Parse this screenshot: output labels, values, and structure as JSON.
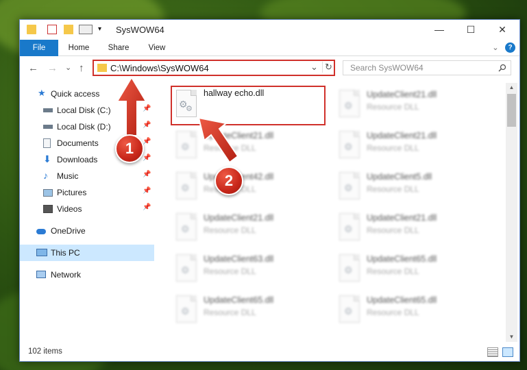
{
  "window": {
    "title": "SysWOW64",
    "minimize_glyph": "—",
    "maximize_glyph": "☐",
    "close_glyph": "✕"
  },
  "ribbon": {
    "tabs": [
      "File",
      "Home",
      "Share",
      "View"
    ],
    "expand_glyph": "⌄",
    "help_glyph": "?"
  },
  "address": {
    "path": "C:\\Windows\\SysWOW64",
    "dropdown_glyph": "⌄",
    "refresh_glyph": "↻"
  },
  "search": {
    "placeholder": "Search SysWOW64",
    "icon": "magnifier-icon"
  },
  "nav": {
    "back": "←",
    "forward": "→",
    "recent": "⌄",
    "up": "↑"
  },
  "sidebar": {
    "items": [
      {
        "label": "Quick access",
        "icon": "star-icon"
      },
      {
        "label": "Local Disk (C:)",
        "icon": "drive-icon",
        "pinned": true
      },
      {
        "label": "Local Disk (D:)",
        "icon": "drive-icon",
        "pinned": true
      },
      {
        "label": "Documents",
        "icon": "documents-icon",
        "pinned": true
      },
      {
        "label": "Downloads",
        "icon": "download-icon",
        "pinned": true
      },
      {
        "label": "Music",
        "icon": "music-icon",
        "pinned": true
      },
      {
        "label": "Pictures",
        "icon": "pictures-icon",
        "pinned": true
      },
      {
        "label": "Videos",
        "icon": "videos-icon",
        "pinned": true
      },
      {
        "label": "OneDrive",
        "icon": "cloud-icon"
      },
      {
        "label": "This PC",
        "icon": "computer-icon",
        "selected": true
      },
      {
        "label": "Network",
        "icon": "network-icon"
      }
    ],
    "pin_glyph": "📌"
  },
  "files": {
    "highlighted": {
      "name": "hallway echo.dll"
    },
    "left_column": [
      {
        "name": "UpdateClient21.dll",
        "type": "Resource DLL"
      },
      {
        "name": "UpdateClient42.dll",
        "type": "Resource DLL"
      },
      {
        "name": "UpdateClient21.dll",
        "type": "Resource DLL"
      },
      {
        "name": "UpdateClient63.dll",
        "type": "Resource DLL"
      },
      {
        "name": "UpdateClient65.dll",
        "type": "Resource DLL"
      }
    ],
    "right_column": [
      {
        "name": "UpdateClient21.dll",
        "type": "Resource DLL"
      },
      {
        "name": "UpdateClient21.dll",
        "type": "Resource DLL"
      },
      {
        "name": "UpdateClient5.dll",
        "type": "Resource DLL"
      },
      {
        "name": "UpdateClient21.dll",
        "type": "Resource DLL"
      },
      {
        "name": "UpdateClient65.dll",
        "type": "Resource DLL"
      },
      {
        "name": "UpdateClient65.dll",
        "type": "Resource DLL"
      }
    ]
  },
  "status": {
    "item_count": "102 items"
  },
  "annotations": {
    "step1": "1",
    "step2": "2",
    "color": "#d0302a"
  }
}
